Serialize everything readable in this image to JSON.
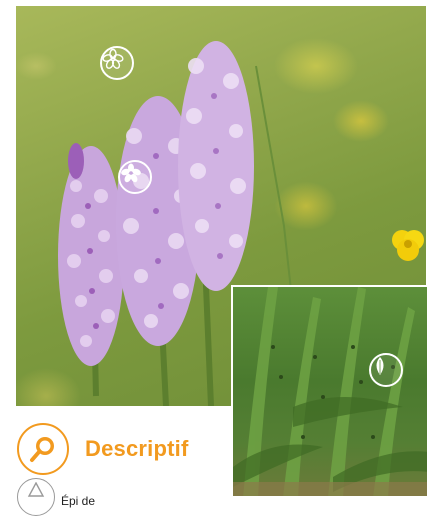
{
  "section": {
    "title": "Descriptif",
    "icon": "search-icon",
    "accent_color": "#f29a1f"
  },
  "subsection": {
    "label": "Épi de",
    "icon": "inflorescence-icon"
  },
  "hotspots": [
    {
      "name": "flower-hotspot-top",
      "icon": "flower-outline-icon"
    },
    {
      "name": "flower-hotspot-middle",
      "icon": "flower-filled-icon"
    },
    {
      "name": "leaf-hotspot",
      "icon": "leaf-icon"
    }
  ]
}
